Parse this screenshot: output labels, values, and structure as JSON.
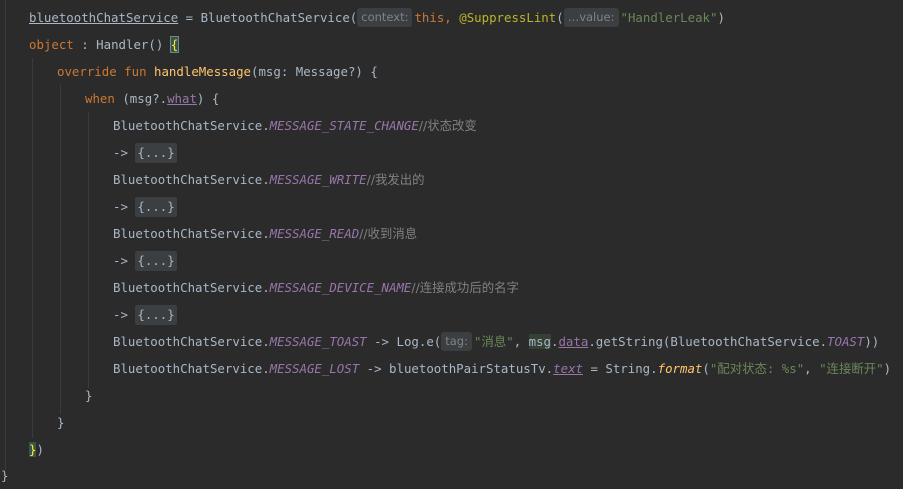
{
  "code": {
    "l1": {
      "field": "bluetoothChatService",
      "assign": " = ",
      "cls": "BluetoothChatService(",
      "hint_context": "context:",
      "this_kw": "this,",
      "annotation": "@SuppressLint",
      "paren": "(",
      "hint_value": "…value:",
      "string": "\"HandlerLeak\"",
      "close": ")"
    },
    "l2": {
      "object_kw": "object",
      "colon": " : ",
      "handler": "Handler()",
      "brace": "{"
    },
    "l3": {
      "override_kw": "override",
      "fun_kw": "fun",
      "fn_name": "handleMessage",
      "params": "(msg: Message?) {"
    },
    "l4": {
      "when_kw": "when",
      "open": "(msg?.",
      "what": "what",
      "close": ") {"
    },
    "l5": {
      "cls": "BluetoothChatService.",
      "konst": "MESSAGE_STATE_CHANGE",
      "comment": "//状态改变"
    },
    "l6": {
      "arrow": "->",
      "fold": "{...}"
    },
    "l7": {
      "cls": "BluetoothChatService.",
      "konst": "MESSAGE_WRITE",
      "comment": "//我发出的"
    },
    "l8": {
      "arrow": "->",
      "fold": "{...}"
    },
    "l9": {
      "cls": "BluetoothChatService.",
      "konst": "MESSAGE_READ",
      "comment": "//收到消息"
    },
    "l10": {
      "arrow": "->",
      "fold": "{...}"
    },
    "l11": {
      "cls": "BluetoothChatService.",
      "konst": "MESSAGE_DEVICE_NAME",
      "comment": "//连接成功后的名字"
    },
    "l12": {
      "arrow": "->",
      "fold": "{...}"
    },
    "l13": {
      "cls": "BluetoothChatService.",
      "konst": "MESSAGE_TOAST",
      "arrow": " -> Log.e(",
      "hint_tag": "tag:",
      "string": "\"消息\"",
      "comma": ", ",
      "msg": "msg",
      "dot": ".",
      "data": "data",
      "get": ".getString(BluetoothChatService.",
      "toast": "TOAST",
      "close": "))"
    },
    "l14": {
      "cls": "BluetoothChatService.",
      "konst": "MESSAGE_LOST",
      "arrow": " -> bluetoothPairStatusTv.",
      "text": "text",
      "eq": " = String.",
      "format": "format",
      "open": "(",
      "string1": "\"配对状态: %s\"",
      "comma": ", ",
      "string2": "\"连接断开\"",
      "close": ")"
    },
    "l15": {
      "brace": "}"
    },
    "l16": {
      "brace": "}"
    },
    "l17": {
      "brace": "}",
      "paren": ")"
    },
    "l18": {
      "brace": "}"
    }
  },
  "colors": {
    "background": "#2b2b2b",
    "text": "#a9b7c6",
    "keyword": "#cc7832",
    "string": "#6a8759",
    "constant": "#9876aa",
    "function": "#ffc66d",
    "comment": "#808080",
    "annotation": "#bbb529"
  }
}
